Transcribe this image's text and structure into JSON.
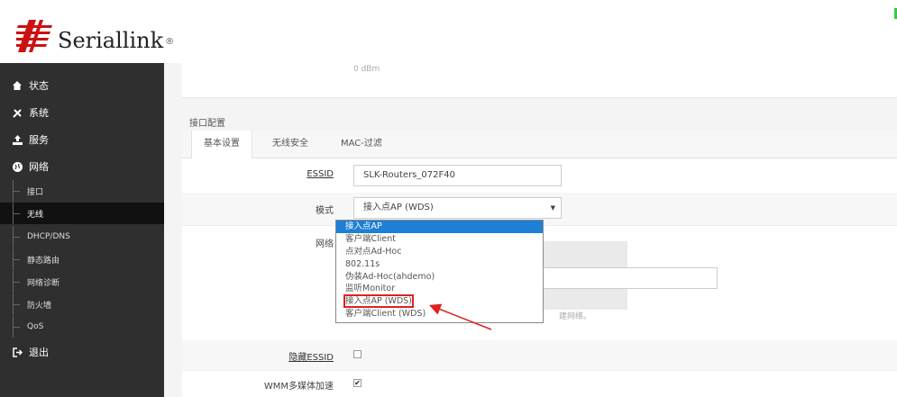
{
  "brand": {
    "name": "Seriallink",
    "reg": "®",
    "color": "#cc1111"
  },
  "nav": {
    "main": [
      {
        "label": "状态",
        "icon": "home-icon"
      },
      {
        "label": "系统",
        "icon": "tools-icon"
      },
      {
        "label": "服务",
        "icon": "upload-icon"
      },
      {
        "label": "网络",
        "icon": "globe-icon"
      },
      {
        "label": "退出",
        "icon": "logout-icon"
      }
    ],
    "sub": [
      {
        "label": "接口"
      },
      {
        "label": "无线",
        "active": true
      },
      {
        "label": "DHCP/DNS"
      },
      {
        "label": "静态路由"
      },
      {
        "label": "网络诊断"
      },
      {
        "label": "防火墙"
      },
      {
        "label": "QoS"
      }
    ]
  },
  "top": {
    "dbm": "0 dBm"
  },
  "section": {
    "title": "接口配置"
  },
  "tabs": [
    {
      "label": "基本设置",
      "active": true
    },
    {
      "label": "无线安全"
    },
    {
      "label": "MAC-过滤"
    }
  ],
  "form": {
    "essid_label": "ESSID",
    "essid_value": "SLK-Routers_072F40",
    "mode_label": "模式",
    "mode_value": "接入点AP (WDS)",
    "network_label": "网络",
    "network_hint": "建网络。",
    "hide_essid_label": "隐藏ESSID",
    "hide_essid_checked": false,
    "wmm_label": "WMM多媒体加速",
    "wmm_checked": true
  },
  "dropdown": {
    "options": [
      {
        "label": "接入点AP",
        "selected": true
      },
      {
        "label": "客户端Client"
      },
      {
        "label": "点对点Ad-Hoc"
      },
      {
        "label": "802.11s"
      },
      {
        "label": "伪装Ad-Hoc(ahdemo)"
      },
      {
        "label": "监听Monitor"
      },
      {
        "label": "接入点AP (WDS)",
        "highlighted": true
      },
      {
        "label": "客户端Client (WDS)"
      }
    ]
  },
  "colors": {
    "accent": "#1e7fd6",
    "annotation": "#dd2222",
    "sidebar": "#2f2f2f"
  }
}
